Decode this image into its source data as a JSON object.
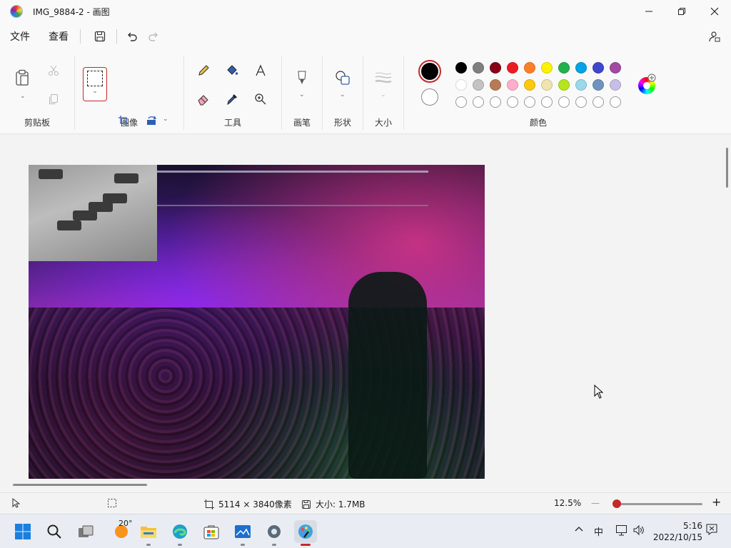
{
  "window": {
    "title": "IMG_9884-2 - 画图"
  },
  "menu": {
    "file": "文件",
    "view": "查看"
  },
  "ribbon": {
    "groups": {
      "clipboard": "剪贴板",
      "image": "图像",
      "tools": "工具",
      "brushes": "画笔",
      "shapes": "形状",
      "size": "大小",
      "colors": "颜色"
    },
    "primary_color": "#000000",
    "secondary_color": "#ffffff",
    "palette_row1": [
      "#000000",
      "#7f7f7f",
      "#880015",
      "#ed1c24",
      "#ff7f27",
      "#fff200",
      "#22b14c",
      "#00a2e8",
      "#3f48cc",
      "#a349a4"
    ],
    "palette_row2": [
      "#ffffff",
      "#c3c3c3",
      "#b97a57",
      "#ffaec9",
      "#ffc90e",
      "#efe4b0",
      "#b5e61d",
      "#99d9ea",
      "#7092be",
      "#c8bfe7"
    ],
    "palette_row3_count": 10
  },
  "status": {
    "dimensions": "5114 × 3840像素",
    "size": "大小: 1.7MB",
    "zoom": "12.5%"
  },
  "taskbar": {
    "weather_temp": "20°",
    "input_method": "中",
    "time": "5:16",
    "date": "2022/10/15"
  },
  "icons": [
    "app-icon",
    "minimize-icon",
    "maximize-icon",
    "close-icon",
    "save-icon",
    "undo-icon",
    "redo-icon",
    "share-icon",
    "paste-icon",
    "cut-icon",
    "copy-icon",
    "crop-icon",
    "resize-icon",
    "rotate-icon",
    "flip-icon",
    "pencil-icon",
    "fill-icon",
    "text-icon",
    "eraser-icon",
    "color-picker-icon",
    "magnifier-icon",
    "brush-icon",
    "shapes-icon",
    "size-icon",
    "edit-colors-icon",
    "pointer-icon",
    "selection-icon",
    "dimension-icon",
    "disk-icon",
    "windows-start-icon",
    "search-icon",
    "task-view-icon",
    "weather-icon",
    "file-explorer-icon",
    "edge-icon",
    "store-icon",
    "photos-icon",
    "settings-icon",
    "paint-icon",
    "chevron-up-icon",
    "network-icon",
    "volume-icon",
    "notification-icon"
  ]
}
